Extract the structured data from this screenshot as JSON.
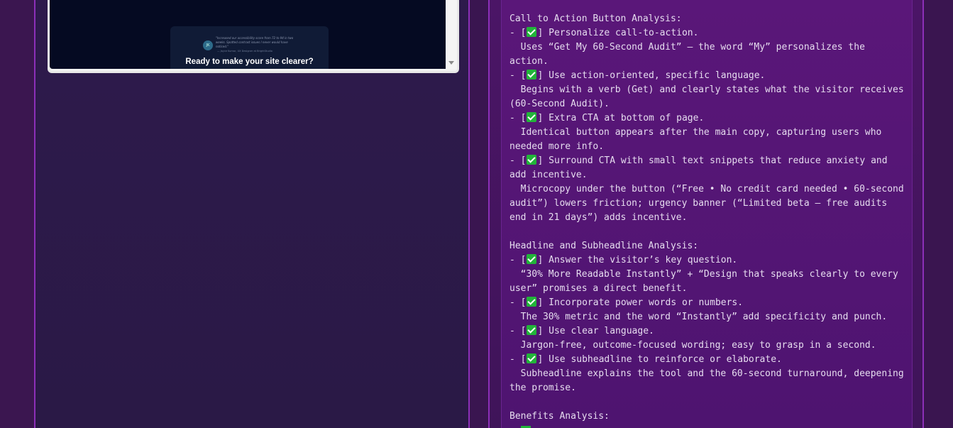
{
  "preview": {
    "avatar_initials": "JK",
    "testimonial_quote": "\"Increased our accessibility score from 72 to 94 in two weeks. Spotted contrast issues I never would have noticed.\"",
    "testimonial_author": "— Jayce Kumar, UX Designer at BrightStudio",
    "cta_heading": "Ready to make your site clearer?"
  },
  "analysis": {
    "lines": [
      {
        "text": "Call to Action Button Analysis:"
      },
      {
        "check": true,
        "text": "Personalize call-to-action."
      },
      {
        "text": "  Uses “Get My 60-Second Audit” — the word “My” personalizes the"
      },
      {
        "text": "action."
      },
      {
        "check": true,
        "text": "Use action-oriented, specific language."
      },
      {
        "text": "  Begins with a verb (Get) and clearly states what the visitor receives"
      },
      {
        "text": "(60-Second Audit)."
      },
      {
        "check": true,
        "text": "Extra CTA at bottom of page."
      },
      {
        "text": "  Identical button appears after the main copy, capturing users who"
      },
      {
        "text": "needed more info."
      },
      {
        "check": true,
        "text": "Surround CTA with small text snippets that reduce anxiety and"
      },
      {
        "text": "add incentive."
      },
      {
        "text": "  Microcopy under the button (“Free • No credit card needed • 60-second"
      },
      {
        "text": "audit”) lowers friction; urgency banner (“Limited beta — free audits"
      },
      {
        "text": "end in 21 days”) adds incentive."
      },
      {
        "blank": true
      },
      {
        "text": "Headline and Subheadline Analysis:"
      },
      {
        "check": true,
        "text": "Answer the visitor’s key question."
      },
      {
        "text": "  “30% More Readable Instantly” + “Design that speaks clearly to every"
      },
      {
        "text": "user” promises a direct benefit."
      },
      {
        "check": true,
        "text": "Incorporate power words or numbers."
      },
      {
        "text": "  The 30% metric and the word “Instantly” add specificity and punch."
      },
      {
        "check": true,
        "text": "Use clear language."
      },
      {
        "text": "  Jargon-free, outcome-focused wording; easy to grasp in a second."
      },
      {
        "check": true,
        "text": "Use subheadline to reinforce or elaborate."
      },
      {
        "text": "  Subheadline explains the tool and the 60-second turnaround, deepening"
      },
      {
        "text": "the promise."
      },
      {
        "blank": true
      },
      {
        "text": "Benefits Analysis:"
      }
    ]
  }
}
